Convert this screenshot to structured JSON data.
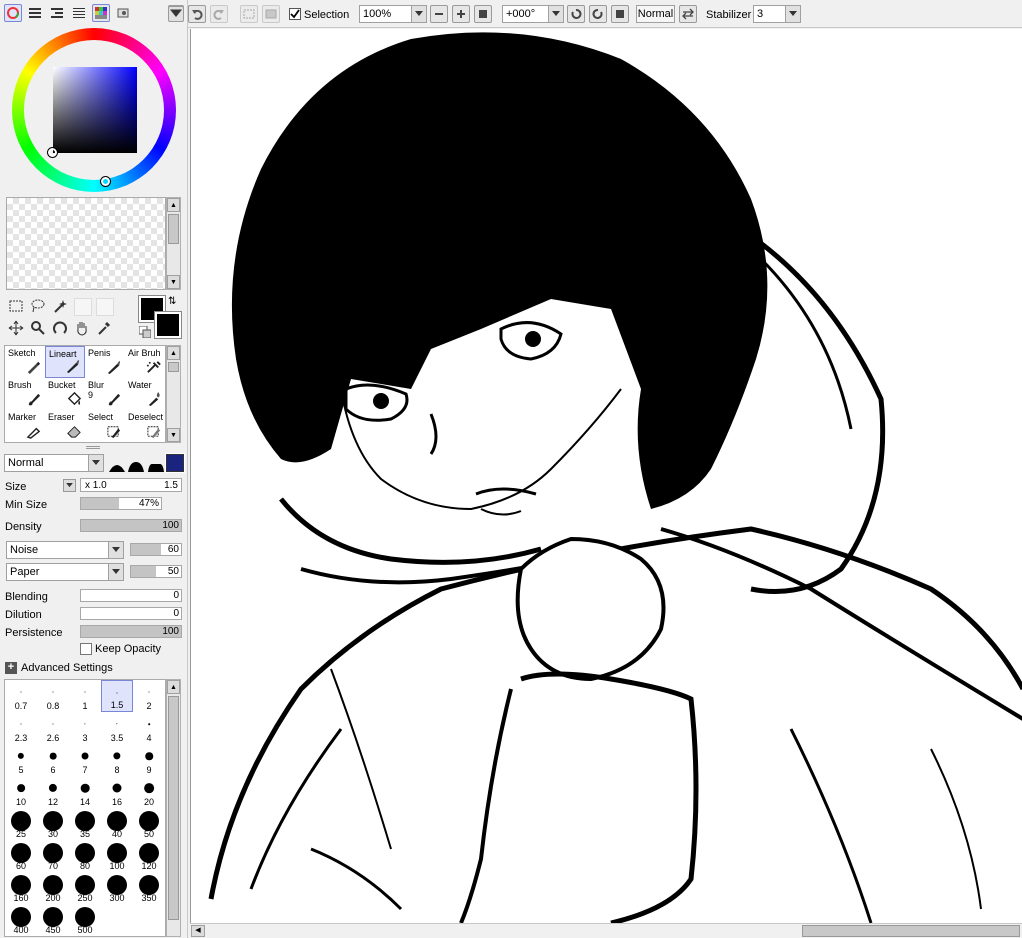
{
  "view_tabs": [
    "color-wheel-icon",
    "color-sliders-icon",
    "color-bars-icon",
    "swatch-list-icon",
    "swatch-grid-icon",
    "scratchpad-icon"
  ],
  "toolbar": {
    "selection_label": "Selection",
    "selection_checked": true,
    "zoom": "100%",
    "rotation": "+000°",
    "blend_mode": "Normal",
    "stabilizer_label": "Stabilizer",
    "stabilizer_value": "3"
  },
  "colors": {
    "primary": "#000000",
    "secondary": "#000000",
    "picker_hue": "#0000ff",
    "selected_tool_bg": "#dfe3fb"
  },
  "tools": [
    {
      "label": "Sketch",
      "icon": "pencil-icon"
    },
    {
      "label": "Lineart",
      "icon": "pen-icon",
      "selected": true
    },
    {
      "label": "Penis",
      "icon": "pen-icon"
    },
    {
      "label": "Air Bruh",
      "icon": "airbrush-icon"
    },
    {
      "label": "Brush",
      "icon": "brush-icon"
    },
    {
      "label": "Bucket",
      "icon": "bucket-icon"
    },
    {
      "label": "Blur",
      "sub": "9",
      "icon": "brush-icon"
    },
    {
      "label": "Water",
      "icon": "water-brush-icon"
    },
    {
      "label": "Marker",
      "icon": "marker-icon"
    },
    {
      "label": "Eraser",
      "icon": "eraser-icon"
    },
    {
      "label": "Select",
      "icon": "select-brush-icon"
    },
    {
      "label": "Deselect",
      "icon": "deselect-brush-icon"
    }
  ],
  "brush": {
    "mode": "Normal",
    "size_label": "Size",
    "size_multiplier": "x 1.0",
    "size_value": "1.5",
    "min_size_label": "Min Size",
    "min_size_value": "47%",
    "min_size_fraction": 0.47,
    "density_label": "Density",
    "density_value": "100",
    "density_fraction": 1.0,
    "texture1": "Noise",
    "texture1_value": "60",
    "texture1_fraction": 0.6,
    "texture2": "Paper",
    "texture2_value": "50",
    "texture2_fraction": 0.5,
    "blending_label": "Blending",
    "blending_value": "0",
    "blending_fraction": 0.0,
    "dilution_label": "Dilution",
    "dilution_value": "0",
    "dilution_fraction": 0.0,
    "persistence_label": "Persistence",
    "persistence_value": "100",
    "persistence_fraction": 1.0,
    "keep_opacity_label": "Keep Opacity",
    "keep_opacity_checked": false,
    "advanced_label": "Advanced Settings"
  },
  "brush_sizes": [
    "0.7",
    "0.8",
    "1",
    "1.5",
    "2",
    "2.3",
    "2.6",
    "3",
    "3.5",
    "4",
    "5",
    "6",
    "7",
    "8",
    "9",
    "10",
    "12",
    "14",
    "16",
    "20",
    "25",
    "30",
    "35",
    "40",
    "50",
    "60",
    "70",
    "80",
    "100",
    "120",
    "160",
    "200",
    "250",
    "300",
    "350",
    "400",
    "450",
    "500"
  ],
  "selected_brush_size": "1.5"
}
